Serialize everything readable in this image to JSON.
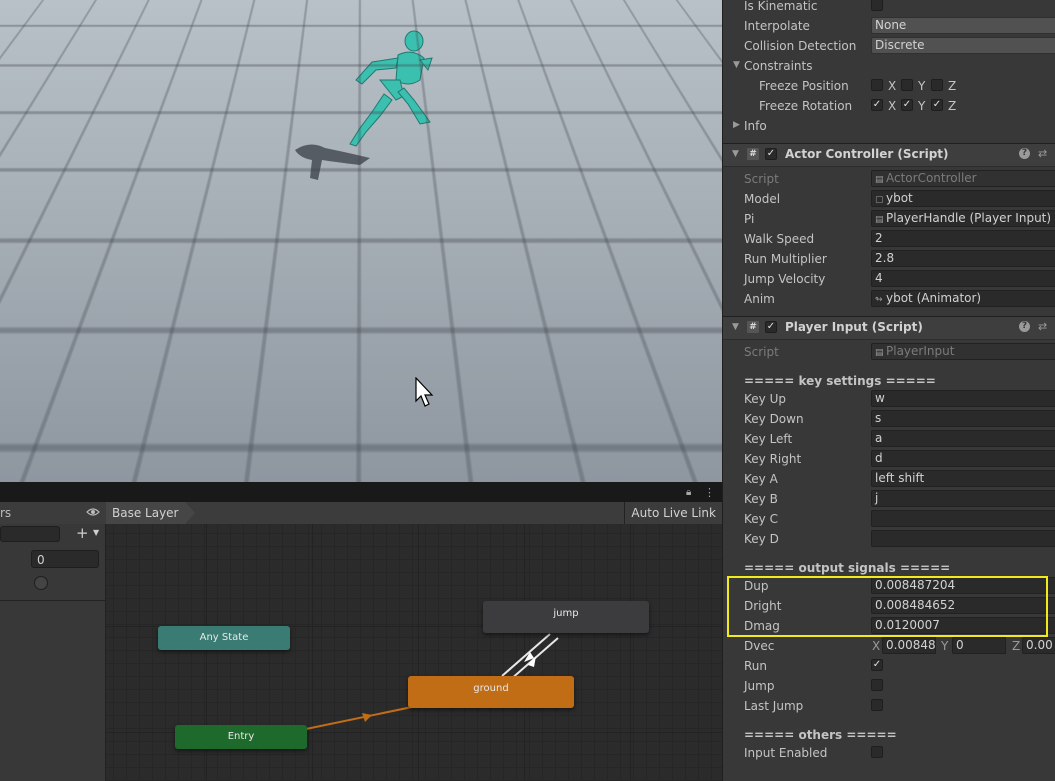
{
  "inspector": {
    "rigidbody": {
      "is_kinematic_label": "Is Kinematic",
      "interpolate_label": "Interpolate",
      "interpolate_value": "None",
      "collision_label": "Collision Detection",
      "collision_value": "Discrete",
      "constraints_label": "Constraints",
      "freeze_position_label": "Freeze Position",
      "freeze_rotation_label": "Freeze Rotation",
      "axis_x": "X",
      "axis_y": "Y",
      "axis_z": "Z",
      "info_label": "Info"
    },
    "actor_controller": {
      "title": "Actor Controller (Script)",
      "fields": [
        {
          "label": "Script",
          "value": "ActorController"
        },
        {
          "label": "Model",
          "value": "ybot"
        },
        {
          "label": "Pi",
          "value": "PlayerHandle (Player Input)"
        },
        {
          "label": "Walk Speed",
          "value": "2"
        },
        {
          "label": "Run Multiplier",
          "value": "2.8"
        },
        {
          "label": "Jump Velocity",
          "value": "4"
        },
        {
          "label": "Anim",
          "value": "ybot (Animator)"
        }
      ]
    },
    "player_input": {
      "title": "Player Input (Script)",
      "script_label": "Script",
      "script_value": "PlayerInput",
      "key_settings_header": "===== key settings =====",
      "keys": [
        {
          "label": "Key Up",
          "value": "w"
        },
        {
          "label": "Key Down",
          "value": "s"
        },
        {
          "label": "Key Left",
          "value": "a"
        },
        {
          "label": "Key Right",
          "value": "d"
        },
        {
          "label": "Key A",
          "value": "left shift"
        },
        {
          "label": "Key B",
          "value": "j"
        },
        {
          "label": "Key C",
          "value": ""
        },
        {
          "label": "Key D",
          "value": ""
        }
      ],
      "output_header": "===== output signals =====",
      "outputs": [
        {
          "label": "Dup",
          "value": "0.008487204"
        },
        {
          "label": "Dright",
          "value": "0.008484652"
        },
        {
          "label": "Dmag",
          "value": "0.0120007"
        }
      ],
      "dvec_label": "Dvec",
      "dvec_x": "0.00848",
      "dvec_y": "0",
      "dvec_z": "0.00",
      "run_label": "Run",
      "jump_label": "Jump",
      "last_jump_label": "Last Jump",
      "others_header": "===== others =====",
      "input_enabled_label": "Input Enabled"
    }
  },
  "animator": {
    "params_tab": "rs",
    "breadcrumb": "Base Layer",
    "auto_live_link": "Auto Live Link",
    "param_value": "0",
    "states": {
      "any_state": "Any State",
      "entry": "Entry",
      "ground": "ground",
      "jump": "jump"
    }
  },
  "colors": {
    "highlight": "#f2ea1d",
    "entry_node": "#1d6a2c",
    "any_state_node": "#3a7c74",
    "ground_node": "#c06d15",
    "jump_node": "#3c3c3e"
  }
}
